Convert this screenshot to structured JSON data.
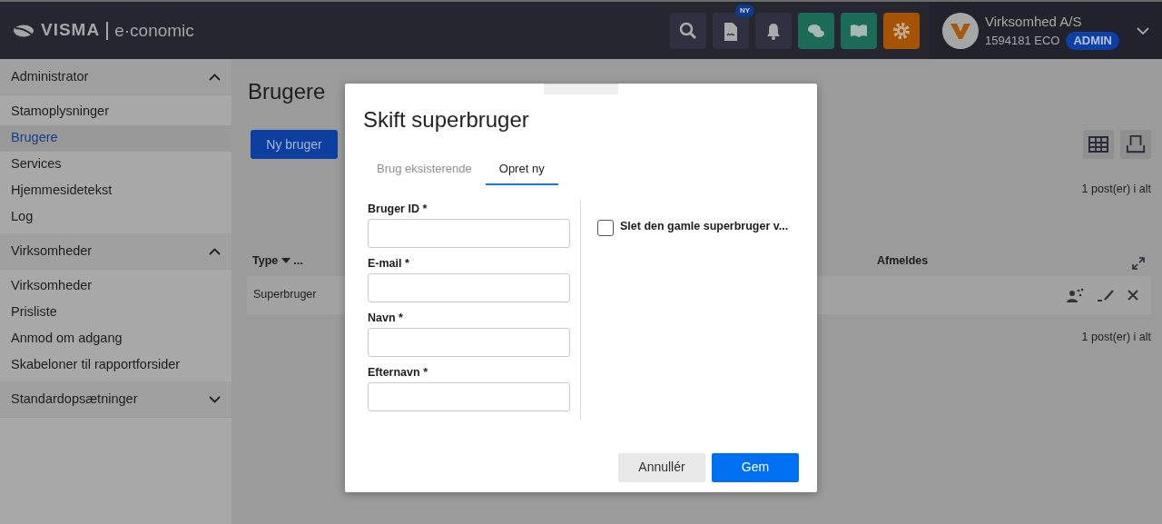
{
  "header": {
    "brand": "VISMA",
    "product": "e·conomic",
    "tools": [
      {
        "kind": "search"
      },
      {
        "kind": "document",
        "badge": "NY"
      },
      {
        "kind": "bell"
      },
      {
        "kind": "chat"
      },
      {
        "kind": "book"
      },
      {
        "kind": "gear"
      }
    ],
    "company": {
      "name": "Virksomhed A/S",
      "account": "1594181 ECO",
      "role": "ADMIN"
    }
  },
  "sidebar": {
    "sections": [
      {
        "title": "Administrator",
        "expanded": true,
        "items": [
          {
            "label": "Stamoplysninger",
            "selected": false
          },
          {
            "label": "Brugere",
            "selected": true
          },
          {
            "label": "Services",
            "selected": false
          },
          {
            "label": "Hjemmesidetekst",
            "selected": false
          },
          {
            "label": "Log",
            "selected": false
          }
        ]
      },
      {
        "title": "Virksomheder",
        "expanded": true,
        "items": [
          {
            "label": "Virksomheder",
            "selected": false
          },
          {
            "label": "Prisliste",
            "selected": false
          },
          {
            "label": "Anmod om adgang",
            "selected": false
          },
          {
            "label": "Skabeloner til rapportforsider",
            "selected": false
          }
        ]
      },
      {
        "title": "Standardopsætninger",
        "expanded": false
      }
    ]
  },
  "page": {
    "title": "Brugere",
    "new_button": "Ny bruger",
    "count_top": "1 post(er) i alt",
    "table": {
      "columns": [
        {
          "label": "Type",
          "sorted": true,
          "more": "..."
        },
        {
          "label": "Afmeldes"
        }
      ],
      "rows": [
        {
          "type": "Superbruger"
        }
      ]
    },
    "count_bottom": "1 post(er) i alt"
  },
  "dialog": {
    "title": "Skift superbruger",
    "tabs": [
      {
        "label": "Brug eksisterende",
        "selected": false
      },
      {
        "label": "Opret ny",
        "selected": true
      }
    ],
    "fields": [
      {
        "label": "Bruger ID *"
      },
      {
        "label": "E-mail *"
      },
      {
        "label": "Navn *"
      },
      {
        "label": "Efternavn *"
      }
    ],
    "checkbox": {
      "label": "Slet den gamle superbruger v...",
      "checked": false
    },
    "buttons": [
      {
        "label": "Annullér",
        "kind": "secondary"
      },
      {
        "label": "Gem",
        "kind": "primary"
      }
    ]
  }
}
